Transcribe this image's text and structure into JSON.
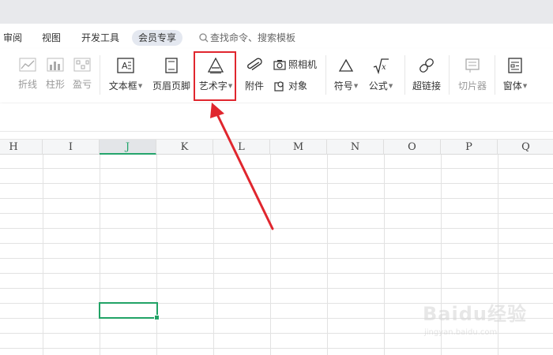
{
  "menubar": {
    "items": [
      "审阅",
      "视图",
      "开发工具",
      "会员专享"
    ],
    "search_placeholder": "查找命令、搜索模板"
  },
  "ribbon": {
    "sparklines": [
      "折线",
      "柱形",
      "盈亏"
    ],
    "textbox": "文本框",
    "header_footer": "页眉页脚",
    "wordart": "艺术字",
    "attachment": "附件",
    "camera": "照相机",
    "object": "对象",
    "symbol": "符号",
    "formula": "公式",
    "hyperlink": "超链接",
    "slicer": "切片器",
    "window": "窗体"
  },
  "columns": [
    "H",
    "I",
    "J",
    "K",
    "L",
    "M",
    "N",
    "O",
    "P",
    "Q"
  ],
  "selected_column": "J",
  "colors": {
    "highlight": "#e0262e",
    "arrow": "#e0262e",
    "selection": "#21a366"
  },
  "watermark": {
    "logo": "Baidu经验",
    "sub": "jingyan.baidu.com"
  }
}
